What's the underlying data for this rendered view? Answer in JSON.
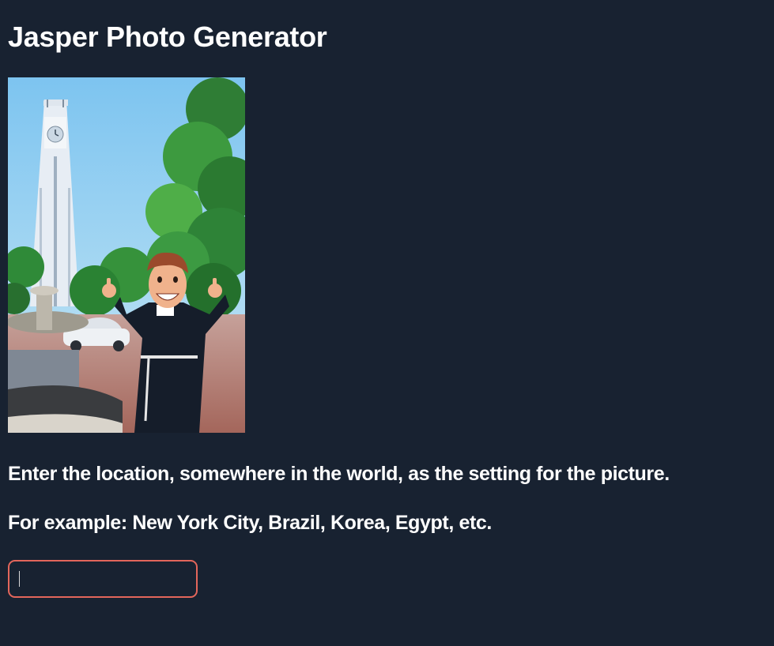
{
  "app": {
    "title": "Jasper Photo Generator"
  },
  "image": {
    "icon": "generated-mascot-photo",
    "colors": {
      "sky": "#87c9ef",
      "tower": "#e8eef5",
      "tree": "#1f8a32",
      "robe": "#151d2a",
      "plaza": "#c09084"
    }
  },
  "instructions": {
    "line1": "Enter the location, somewhere in the world, as the setting for the picture.",
    "line2": "For example: New York City, Brazil, Korea, Egypt, etc."
  },
  "input": {
    "value": "",
    "placeholder": ""
  },
  "colors": {
    "background": "#182231",
    "text": "#ffffff",
    "input_border": "#e3665b"
  }
}
